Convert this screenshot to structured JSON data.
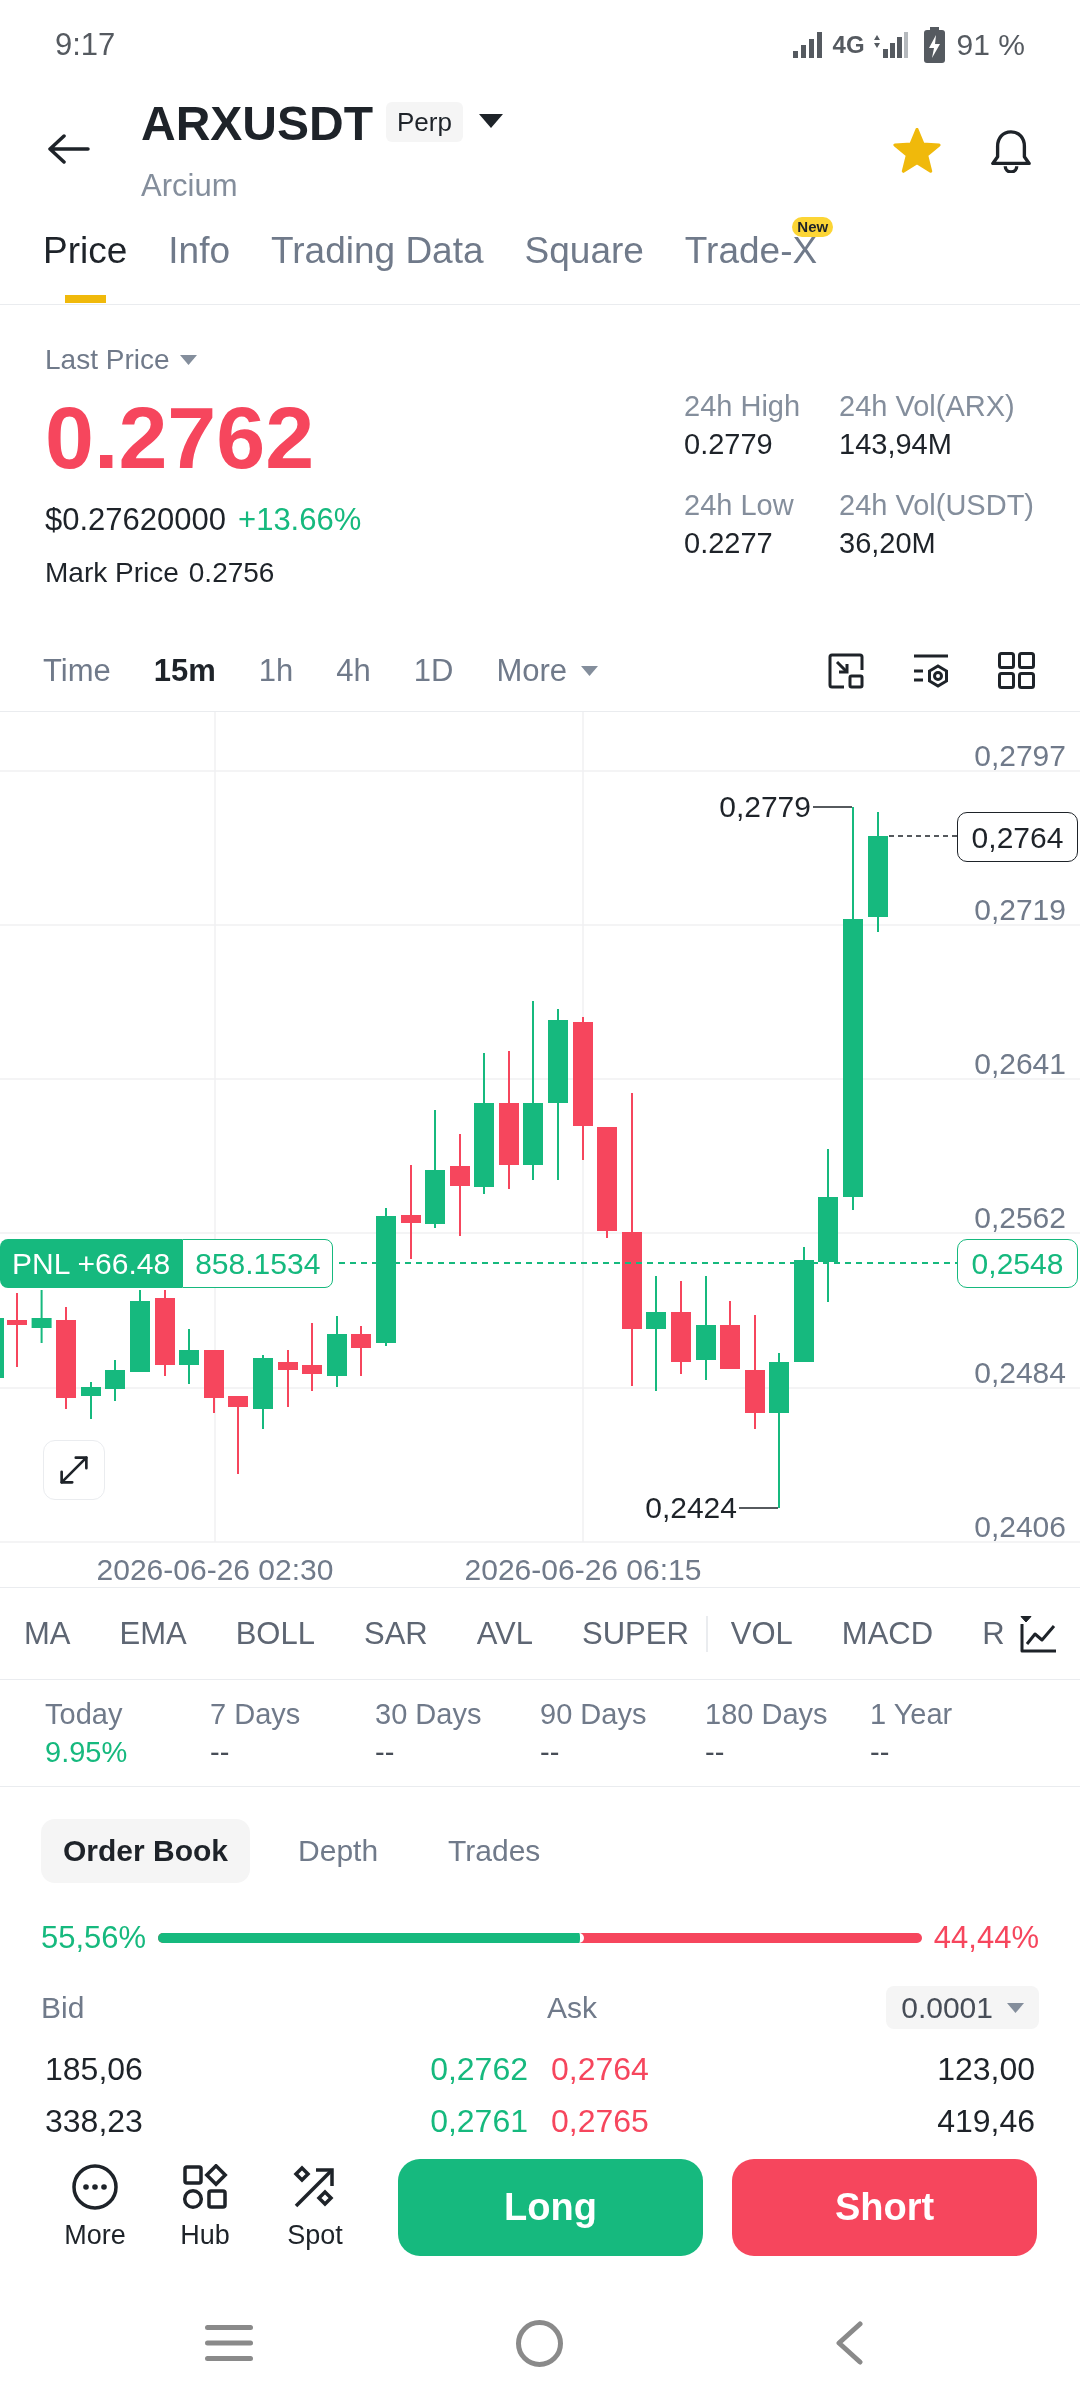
{
  "status_bar": {
    "time": "9:17",
    "network": "4G",
    "battery": "91 %"
  },
  "header": {
    "symbol": "ARXUSDT",
    "contract": "Perp",
    "name": "Arcium",
    "favorite": true
  },
  "tabs": [
    {
      "label": "Price",
      "selected": true
    },
    {
      "label": "Info",
      "selected": false
    },
    {
      "label": "Trading Data",
      "selected": false
    },
    {
      "label": "Square",
      "selected": false
    },
    {
      "label": "Trade-X",
      "selected": false,
      "badge": "New"
    }
  ],
  "price": {
    "label": "Last Price",
    "value": "0.2762",
    "down": true,
    "usd_value": "$0.27620000",
    "change": "+13.66%",
    "mark_label": "Mark Price",
    "mark_value": "0.2756"
  },
  "stats": [
    {
      "label": "24h High",
      "value": "0.2779"
    },
    {
      "label": "24h Vol(ARX)",
      "value": "143,94M"
    },
    {
      "label": "24h Low",
      "value": "0.2277"
    },
    {
      "label": "24h Vol(USDT)",
      "value": "36,20M"
    }
  ],
  "intervals": [
    {
      "label": "Time",
      "selected": false
    },
    {
      "label": "15m",
      "selected": true
    },
    {
      "label": "1h",
      "selected": false
    },
    {
      "label": "4h",
      "selected": false
    },
    {
      "label": "1D",
      "selected": false
    }
  ],
  "interval_more": "More",
  "chart": {
    "y_labels": [
      "0,2797",
      "0,2719",
      "0,2641",
      "0,2562",
      "0,2484",
      "0,2406"
    ],
    "x_labels": [
      "2026-06-26 02:30",
      "2026-06-26 06:15"
    ],
    "high_label": "0,2779",
    "low_label": "0,2424",
    "last_price_tag": "0,2764",
    "position": {
      "pnl": "PNL +66.48",
      "entry": "858.1534",
      "price_tag": "0,2548"
    }
  },
  "indicators": {
    "main": [
      "MA",
      "EMA",
      "BOLL",
      "SAR",
      "AVL",
      "SUPER"
    ],
    "sub": [
      "VOL",
      "MACD",
      "R"
    ]
  },
  "returns": [
    {
      "label": "Today",
      "value": "9.95%",
      "positive": true
    },
    {
      "label": "7 Days",
      "value": "--",
      "positive": false
    },
    {
      "label": "30 Days",
      "value": "--",
      "positive": false
    },
    {
      "label": "90 Days",
      "value": "--",
      "positive": false
    },
    {
      "label": "180 Days",
      "value": "--",
      "positive": false
    },
    {
      "label": "1 Year",
      "value": "--",
      "positive": false
    }
  ],
  "order_book": {
    "tabs": [
      {
        "label": "Order Book",
        "selected": true
      },
      {
        "label": "Depth",
        "selected": false
      },
      {
        "label": "Trades",
        "selected": false
      }
    ],
    "bid_ratio": "55,56%",
    "ask_ratio": "44,44%",
    "level": 0.5556,
    "bid_label": "Bid",
    "ask_label": "Ask",
    "precision": "0.0001",
    "rows": [
      {
        "bid_qty": "185,06",
        "bid_price": "0,2762",
        "ask_price": "0,2764",
        "ask_qty": "123,00"
      },
      {
        "bid_qty": "338,23",
        "bid_price": "0,2761",
        "ask_price": "0,2765",
        "ask_qty": "419,46"
      }
    ]
  },
  "actions": [
    {
      "kind": "more",
      "label": "More"
    },
    {
      "kind": "hub",
      "label": "Hub"
    },
    {
      "kind": "spot",
      "label": "Spot"
    }
  ],
  "trade_buttons": [
    {
      "kind": "long",
      "label": "Long"
    },
    {
      "kind": "short",
      "label": "Short"
    }
  ]
}
